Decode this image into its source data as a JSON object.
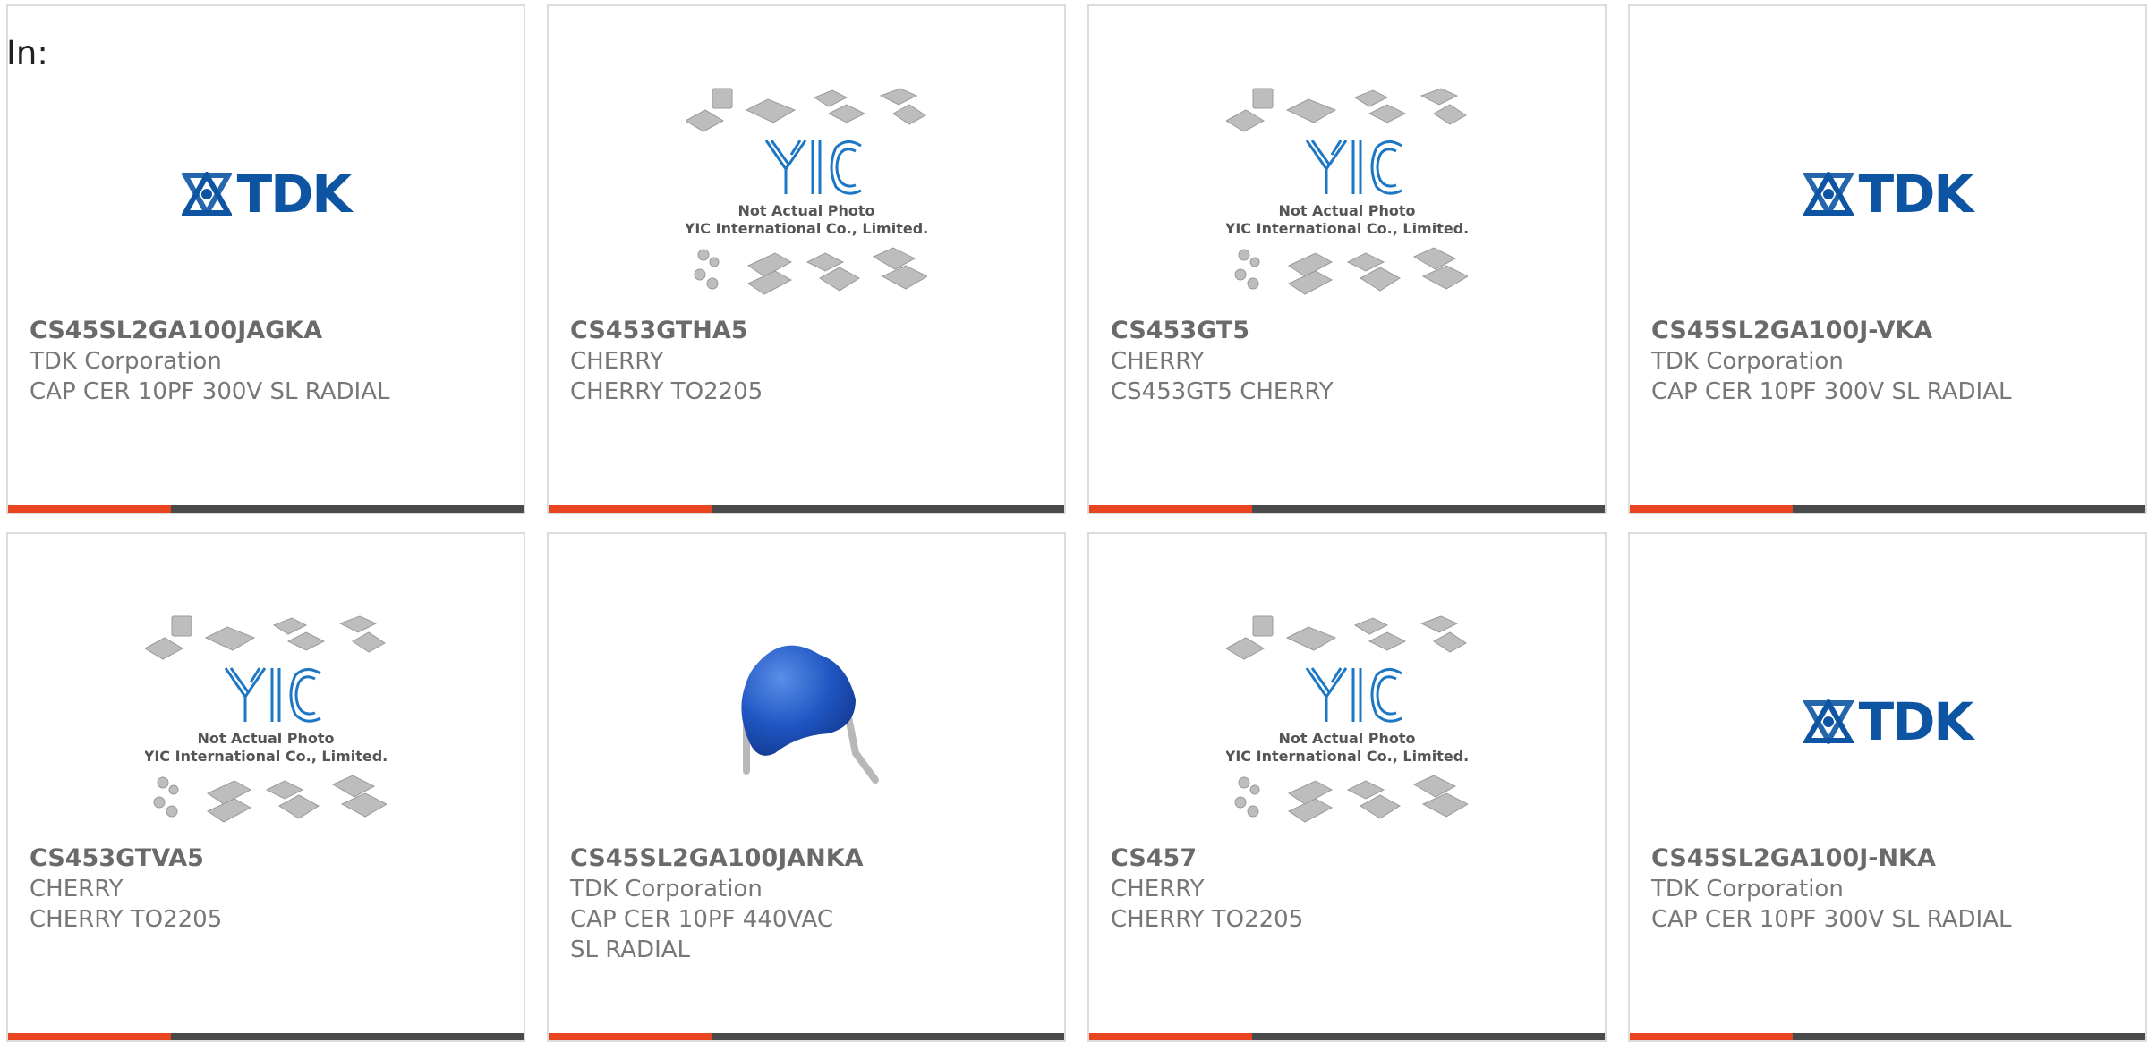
{
  "prefix_label": "In:",
  "colors": {
    "accent": "#e8441f",
    "bar": "#4a4a4a",
    "tdk_blue": "#0d55a3",
    "text": "#777777"
  },
  "cards": [
    {
      "image": "tdk-logo",
      "part_number": "CS45SL2GA100JAGKA",
      "manufacturer": "TDK Corporation",
      "description": "CAP CER 10PF 300V SL RADIAL"
    },
    {
      "image": "yic-not-actual-photo",
      "image_caption_1": "Not Actual Photo",
      "image_caption_2": "YIC International Co., Limited.",
      "part_number": "CS453GTHA5",
      "manufacturer": "CHERRY",
      "description": "CHERRY TO2205"
    },
    {
      "image": "yic-not-actual-photo",
      "image_caption_1": "Not Actual Photo",
      "image_caption_2": "YIC International Co., Limited.",
      "part_number": "CS453GT5",
      "manufacturer": "CHERRY",
      "description": "CS453GT5 CHERRY"
    },
    {
      "image": "tdk-logo",
      "part_number": "CS45SL2GA100J-VKA",
      "manufacturer": "TDK Corporation",
      "description": "CAP CER 10PF 300V SL RADIAL"
    },
    {
      "image": "yic-not-actual-photo",
      "image_caption_1": "Not Actual Photo",
      "image_caption_2": "YIC International Co., Limited.",
      "part_number": "CS453GTVA5",
      "manufacturer": "CHERRY",
      "description": "CHERRY TO2205"
    },
    {
      "image": "blue-ceramic-capacitor-photo",
      "part_number": "CS45SL2GA100JANKA",
      "manufacturer": "TDK Corporation",
      "description": "CAP CER 10PF 440VAC SL RADIAL"
    },
    {
      "image": "yic-not-actual-photo",
      "image_caption_1": "Not Actual Photo",
      "image_caption_2": "YIC International Co., Limited.",
      "part_number": "CS457",
      "manufacturer": "CHERRY",
      "description": "CHERRY TO2205"
    },
    {
      "image": "tdk-logo",
      "part_number": "CS45SL2GA100J-NKA",
      "manufacturer": "TDK Corporation",
      "description": "CAP CER 10PF 300V SL RADIAL"
    }
  ]
}
